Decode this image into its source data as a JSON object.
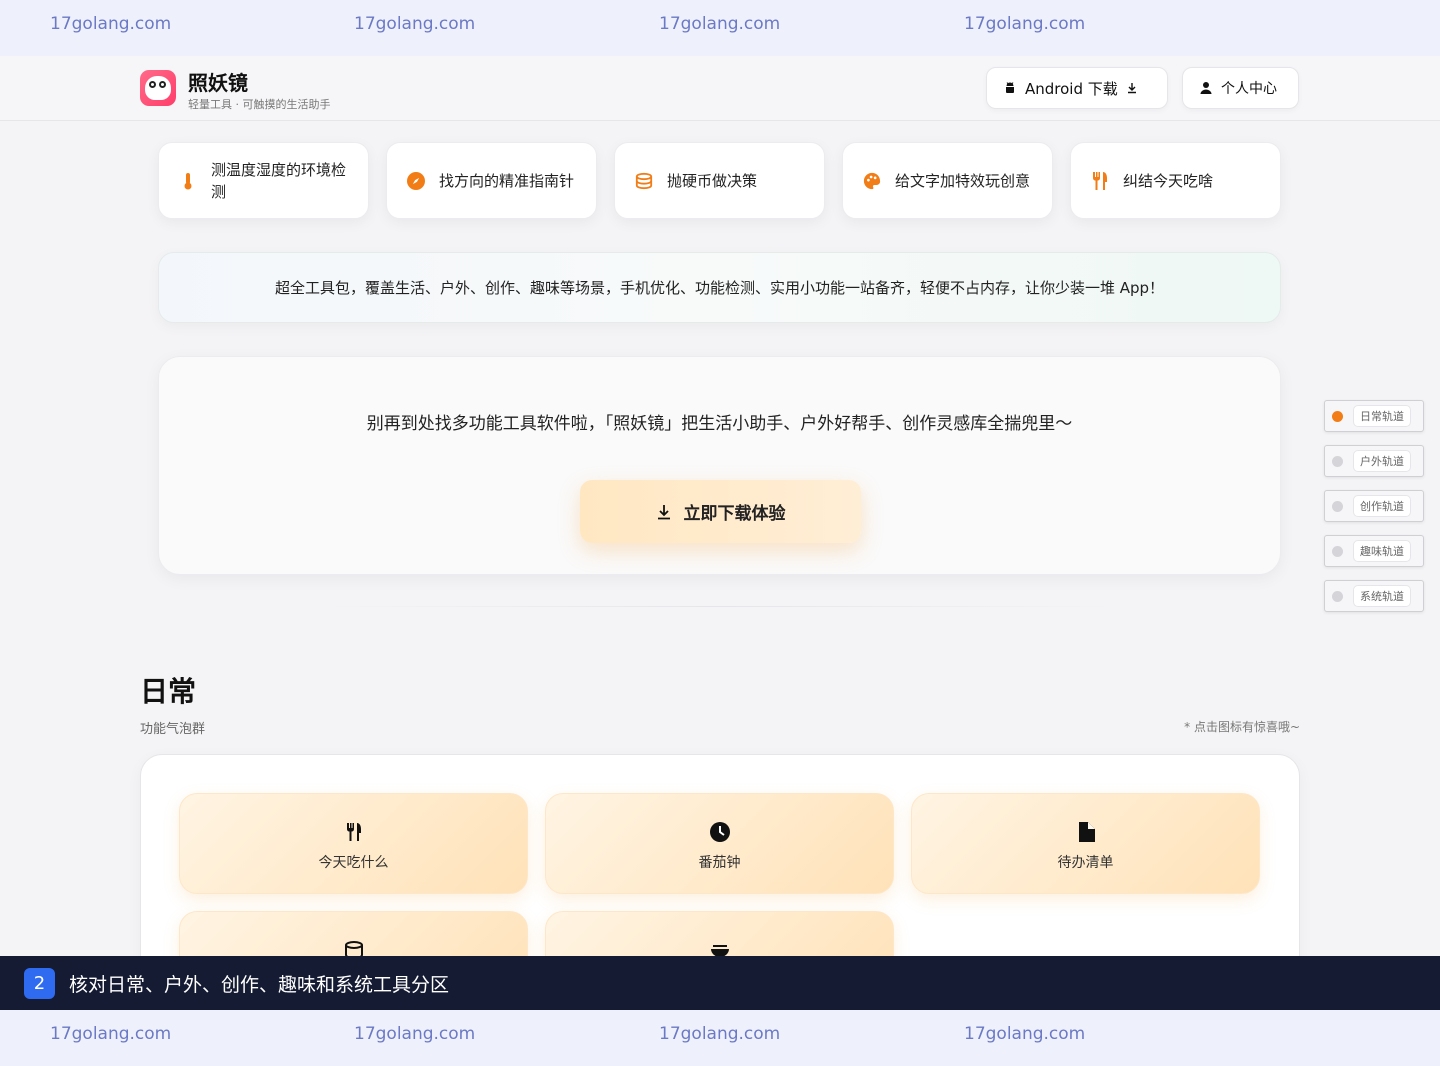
{
  "watermark": {
    "text": "17golang.com"
  },
  "header": {
    "brand_name": "照妖镜",
    "brand_sub": "轻量工具 · 可触摸的生活助手",
    "android_label": "Android 下载",
    "profile_label": "个人中心"
  },
  "chips": [
    {
      "icon": "thermometer-icon",
      "label": "测温度湿度的环境检测"
    },
    {
      "icon": "compass-icon",
      "label": "找方向的精准指南针"
    },
    {
      "icon": "coins-icon",
      "label": "抛硬币做决策"
    },
    {
      "icon": "palette-icon",
      "label": "给文字加特效玩创意"
    },
    {
      "icon": "utensils-icon",
      "label": "纠结今天吃啥"
    }
  ],
  "banner": {
    "text": "超全工具包，覆盖生活、户外、创作、趣味等场景，手机优化、功能检测、实用小功能一站备齐，轻便不占内存，让你少装一堆 App！"
  },
  "hero": {
    "text": "别再到处找多功能工具软件啦，「照妖镜」把生活小助手、户外好帮手、创作灵感库全揣兜里～",
    "cta_label": "立即下载体验"
  },
  "rail": [
    {
      "label": "日常轨道",
      "active": true
    },
    {
      "label": "户外轨道",
      "active": false
    },
    {
      "label": "创作轨道",
      "active": false
    },
    {
      "label": "趣味轨道",
      "active": false
    },
    {
      "label": "系统轨道",
      "active": false
    }
  ],
  "section": {
    "title": "日常",
    "subtitle": "功能气泡群",
    "hint": "* 点击图标有惊喜哦~"
  },
  "tiles": [
    {
      "icon": "utensils-icon",
      "label": "今天吃什么"
    },
    {
      "icon": "clock-icon",
      "label": "番茄钟"
    },
    {
      "icon": "file-icon",
      "label": "待办清单"
    },
    {
      "icon": "coins-icon",
      "label": ""
    },
    {
      "icon": "bowl-icon",
      "label": ""
    }
  ],
  "caption": {
    "number": "2",
    "text": "核对日常、户外、创作、趣味和系统工具分区"
  },
  "colors": {
    "accent": "#f27d16",
    "caption_bg": "#141b33",
    "caption_badge": "#2f6bf0"
  }
}
